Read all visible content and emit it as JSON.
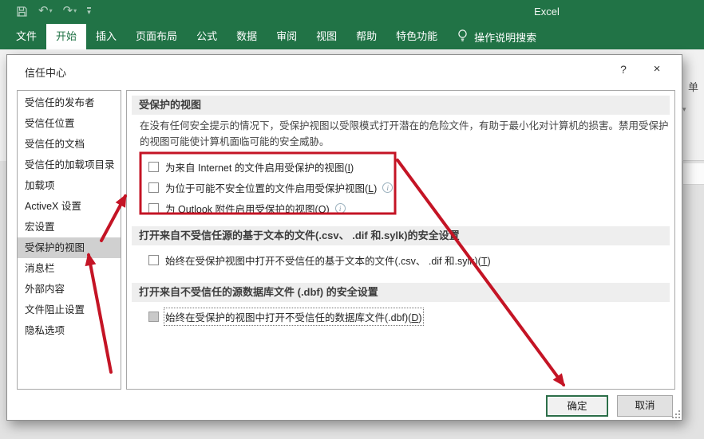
{
  "titlebar": {
    "app_title": "Excel",
    "quick_access_icons": [
      "save-icon",
      "undo-icon",
      "redo-icon",
      "customize-quick-access-icon"
    ]
  },
  "glyphs": {
    "undo": "↶",
    "redo": "↷",
    "caret": "▾",
    "help": "?",
    "close": "×"
  },
  "ribbon": {
    "tabs": [
      "文件",
      "开始",
      "插入",
      "页面布局",
      "公式",
      "数据",
      "审阅",
      "视图",
      "帮助",
      "特色功能"
    ],
    "active_tab": "开始",
    "search_icon": "lightbulb-icon",
    "search_label": "操作说明搜索",
    "right_strip_text": "单"
  },
  "dialog": {
    "title": "信任中心",
    "sidebar": [
      "受信任的发布者",
      "受信任位置",
      "受信任的文档",
      "受信任的加载项目录",
      "加载项",
      "ActiveX 设置",
      "宏设置",
      "受保护的视图",
      "消息栏",
      "外部内容",
      "文件阻止设置",
      "隐私选项"
    ],
    "selected_item": "受保护的视图",
    "sections": {
      "protected_view": {
        "header": "受保护的视图",
        "desc": "在没有任何安全提示的情况下，受保护视图以受限模式打开潜在的危险文件，有助于最小化对计算机的损害。禁用受保护的视图可能使计算机面临可能的安全威胁。",
        "cb1": {
          "pre": "为来自 Internet 的文件启用受保护的视图(",
          "accel": "I",
          "post": ")",
          "checked": false
        },
        "cb2": {
          "pre": "为位于可能不安全位置的文件启用受保护视图(",
          "accel": "L",
          "post": ")",
          "checked": false,
          "info": true
        },
        "cb3": {
          "pre": "为 Outlook 附件启用受保护的视图(",
          "accel": "O",
          "post": ")",
          "checked": false,
          "info": true
        }
      },
      "text_files": {
        "header": "打开来自不受信任源的基于文本的文件(.csv、 .dif 和.sylk)的安全设置",
        "cb": {
          "pre": "始终在受保护视图中打开不受信任的基于文本的文件(.csv、 .dif 和.sylk)(",
          "accel": "T",
          "post": ")",
          "checked": false
        }
      },
      "dbf_files": {
        "header": "打开来自不受信任的源数据库文件 (.dbf) 的安全设置",
        "cb": {
          "pre": "始终在受保护的视图中打开不受信任的数据库文件(.dbf)(",
          "accel": "D",
          "post": ")",
          "checked": false,
          "disabled": true,
          "focused": true
        }
      }
    },
    "buttons": {
      "ok": "确定",
      "cancel": "取消"
    }
  },
  "annotations": {
    "color": "#c41425",
    "rect_highlights_protected_view_checkboxes": true,
    "arrows": [
      "sidebar-selected-to-checkbox-group",
      "bottom-to-sidebar-selected",
      "checkbox-group-to-ok-button"
    ]
  }
}
